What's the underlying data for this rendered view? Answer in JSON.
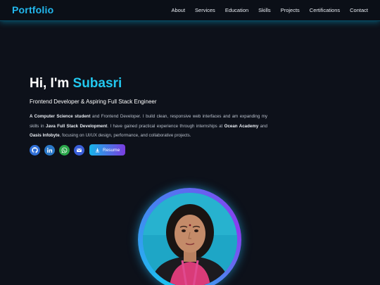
{
  "nav": {
    "brand": "Portfolio",
    "links": [
      "About",
      "Services",
      "Education",
      "Skills",
      "Projects",
      "Certifications",
      "Contact"
    ]
  },
  "hero": {
    "greeting": "Hi, I'm ",
    "name": "Subasri",
    "subtitle": "Frontend Developer & Aspiring Full Stack Engineer",
    "desc": {
      "p1b": "A Computer Science student",
      "p2": " and Frontend Developer. I build clean, responsive web interfaces and am expanding my skills in ",
      "p3b": "Java Full Stack Development",
      "p4": ". I have gained practical experience through internships at ",
      "p5b": "Ocean Academy",
      "p6": " and ",
      "p7b": "Oasis Infobyte",
      "p8": ", focusing on UI/UX design, performance, and collaborative projects."
    },
    "resume_label": "Resume",
    "icons": [
      "github-icon",
      "linkedin-icon",
      "whatsapp-icon",
      "mail-icon",
      "download-icon"
    ]
  },
  "colors": {
    "accent": "#22c7ee",
    "background": "#0d111a",
    "ring_start": "#19c4f0",
    "ring_end": "#8a3df0"
  }
}
